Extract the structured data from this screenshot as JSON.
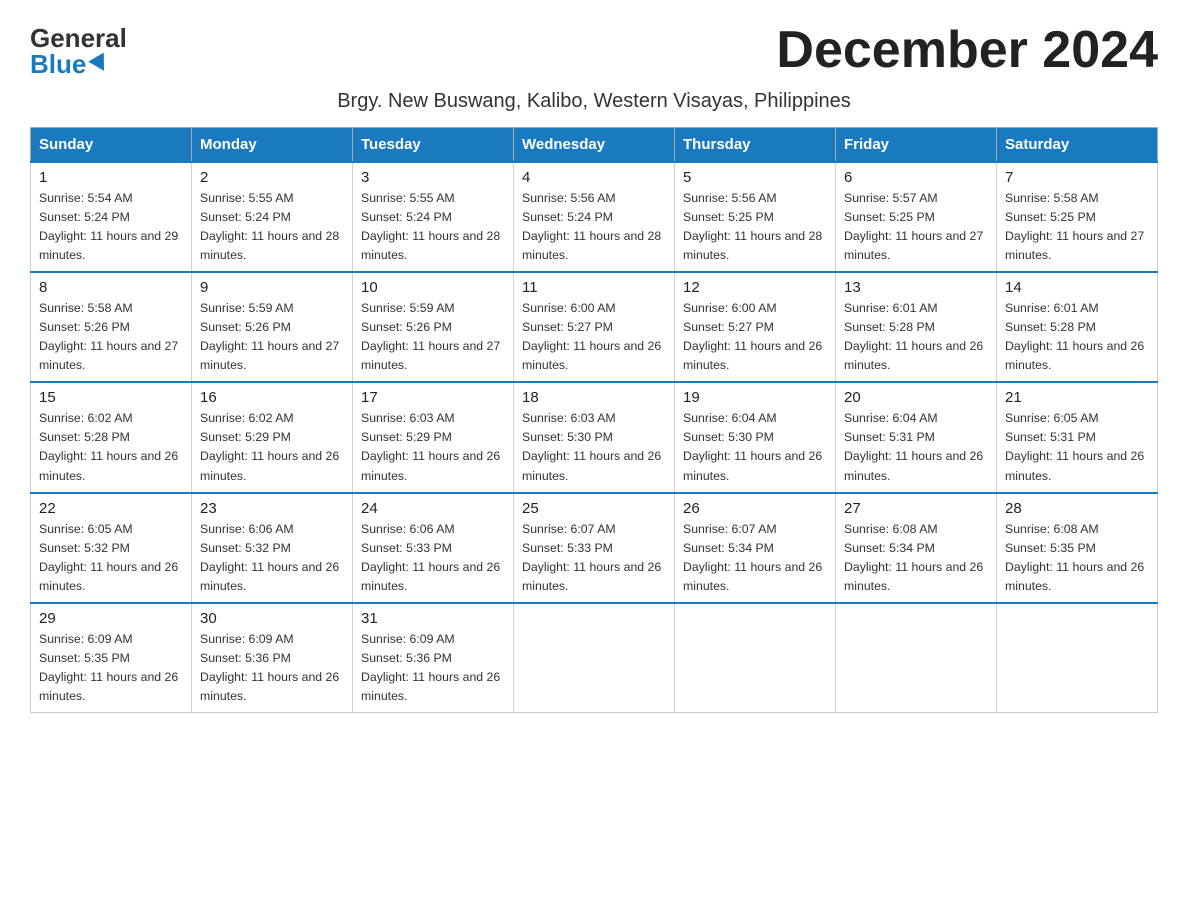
{
  "logo": {
    "general": "General",
    "blue": "Blue"
  },
  "title": "December 2024",
  "subtitle": "Brgy. New Buswang, Kalibo, Western Visayas, Philippines",
  "weekdays": [
    "Sunday",
    "Monday",
    "Tuesday",
    "Wednesday",
    "Thursday",
    "Friday",
    "Saturday"
  ],
  "weeks": [
    [
      {
        "day": "1",
        "sunrise": "5:54 AM",
        "sunset": "5:24 PM",
        "daylight": "11 hours and 29 minutes."
      },
      {
        "day": "2",
        "sunrise": "5:55 AM",
        "sunset": "5:24 PM",
        "daylight": "11 hours and 28 minutes."
      },
      {
        "day": "3",
        "sunrise": "5:55 AM",
        "sunset": "5:24 PM",
        "daylight": "11 hours and 28 minutes."
      },
      {
        "day": "4",
        "sunrise": "5:56 AM",
        "sunset": "5:24 PM",
        "daylight": "11 hours and 28 minutes."
      },
      {
        "day": "5",
        "sunrise": "5:56 AM",
        "sunset": "5:25 PM",
        "daylight": "11 hours and 28 minutes."
      },
      {
        "day": "6",
        "sunrise": "5:57 AM",
        "sunset": "5:25 PM",
        "daylight": "11 hours and 27 minutes."
      },
      {
        "day": "7",
        "sunrise": "5:58 AM",
        "sunset": "5:25 PM",
        "daylight": "11 hours and 27 minutes."
      }
    ],
    [
      {
        "day": "8",
        "sunrise": "5:58 AM",
        "sunset": "5:26 PM",
        "daylight": "11 hours and 27 minutes."
      },
      {
        "day": "9",
        "sunrise": "5:59 AM",
        "sunset": "5:26 PM",
        "daylight": "11 hours and 27 minutes."
      },
      {
        "day": "10",
        "sunrise": "5:59 AM",
        "sunset": "5:26 PM",
        "daylight": "11 hours and 27 minutes."
      },
      {
        "day": "11",
        "sunrise": "6:00 AM",
        "sunset": "5:27 PM",
        "daylight": "11 hours and 26 minutes."
      },
      {
        "day": "12",
        "sunrise": "6:00 AM",
        "sunset": "5:27 PM",
        "daylight": "11 hours and 26 minutes."
      },
      {
        "day": "13",
        "sunrise": "6:01 AM",
        "sunset": "5:28 PM",
        "daylight": "11 hours and 26 minutes."
      },
      {
        "day": "14",
        "sunrise": "6:01 AM",
        "sunset": "5:28 PM",
        "daylight": "11 hours and 26 minutes."
      }
    ],
    [
      {
        "day": "15",
        "sunrise": "6:02 AM",
        "sunset": "5:28 PM",
        "daylight": "11 hours and 26 minutes."
      },
      {
        "day": "16",
        "sunrise": "6:02 AM",
        "sunset": "5:29 PM",
        "daylight": "11 hours and 26 minutes."
      },
      {
        "day": "17",
        "sunrise": "6:03 AM",
        "sunset": "5:29 PM",
        "daylight": "11 hours and 26 minutes."
      },
      {
        "day": "18",
        "sunrise": "6:03 AM",
        "sunset": "5:30 PM",
        "daylight": "11 hours and 26 minutes."
      },
      {
        "day": "19",
        "sunrise": "6:04 AM",
        "sunset": "5:30 PM",
        "daylight": "11 hours and 26 minutes."
      },
      {
        "day": "20",
        "sunrise": "6:04 AM",
        "sunset": "5:31 PM",
        "daylight": "11 hours and 26 minutes."
      },
      {
        "day": "21",
        "sunrise": "6:05 AM",
        "sunset": "5:31 PM",
        "daylight": "11 hours and 26 minutes."
      }
    ],
    [
      {
        "day": "22",
        "sunrise": "6:05 AM",
        "sunset": "5:32 PM",
        "daylight": "11 hours and 26 minutes."
      },
      {
        "day": "23",
        "sunrise": "6:06 AM",
        "sunset": "5:32 PM",
        "daylight": "11 hours and 26 minutes."
      },
      {
        "day": "24",
        "sunrise": "6:06 AM",
        "sunset": "5:33 PM",
        "daylight": "11 hours and 26 minutes."
      },
      {
        "day": "25",
        "sunrise": "6:07 AM",
        "sunset": "5:33 PM",
        "daylight": "11 hours and 26 minutes."
      },
      {
        "day": "26",
        "sunrise": "6:07 AM",
        "sunset": "5:34 PM",
        "daylight": "11 hours and 26 minutes."
      },
      {
        "day": "27",
        "sunrise": "6:08 AM",
        "sunset": "5:34 PM",
        "daylight": "11 hours and 26 minutes."
      },
      {
        "day": "28",
        "sunrise": "6:08 AM",
        "sunset": "5:35 PM",
        "daylight": "11 hours and 26 minutes."
      }
    ],
    [
      {
        "day": "29",
        "sunrise": "6:09 AM",
        "sunset": "5:35 PM",
        "daylight": "11 hours and 26 minutes."
      },
      {
        "day": "30",
        "sunrise": "6:09 AM",
        "sunset": "5:36 PM",
        "daylight": "11 hours and 26 minutes."
      },
      {
        "day": "31",
        "sunrise": "6:09 AM",
        "sunset": "5:36 PM",
        "daylight": "11 hours and 26 minutes."
      },
      null,
      null,
      null,
      null
    ]
  ],
  "labels": {
    "sunrise": "Sunrise:",
    "sunset": "Sunset:",
    "daylight": "Daylight:"
  }
}
